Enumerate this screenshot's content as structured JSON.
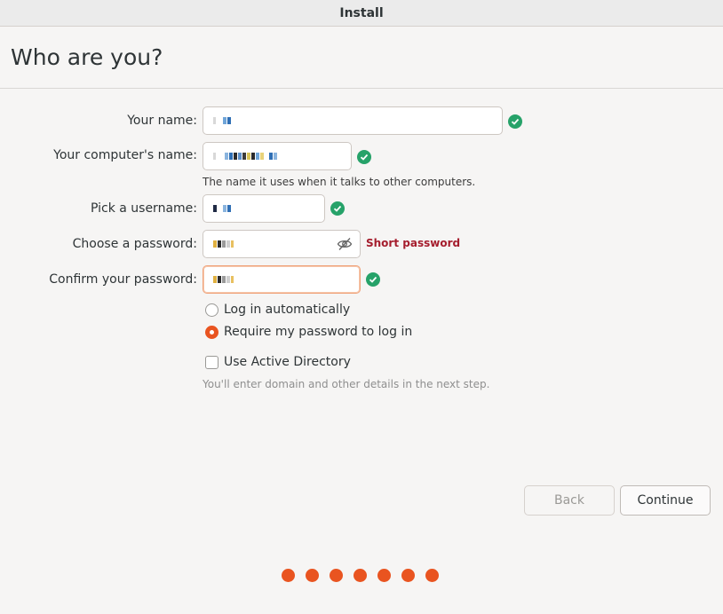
{
  "window": {
    "title": "Install"
  },
  "page": {
    "title": "Who are you?"
  },
  "form": {
    "name_label": "Your name:",
    "computer_label": "Your computer's name:",
    "computer_hint": "The name it uses when it talks to other computers.",
    "username_label": "Pick a username:",
    "password_label": "Choose a password:",
    "password_strength": "Short password",
    "confirm_label": "Confirm your password:",
    "login_auto": "Log in automatically",
    "login_require": "Require my password to log in",
    "login_selected": "Require my password to log in",
    "active_directory": "Use Active Directory",
    "active_directory_checked": false,
    "ad_hint": "You'll enter domain and other details in the next step."
  },
  "buttons": {
    "back": "Back",
    "continue": "Continue"
  },
  "progress": {
    "steps_total": 7
  },
  "colors": {
    "accent": "#e95420",
    "success": "#26a269",
    "error": "#a51d2d"
  },
  "icons": {
    "valid": "check-circle-icon",
    "reveal": "eye-off-icon"
  }
}
